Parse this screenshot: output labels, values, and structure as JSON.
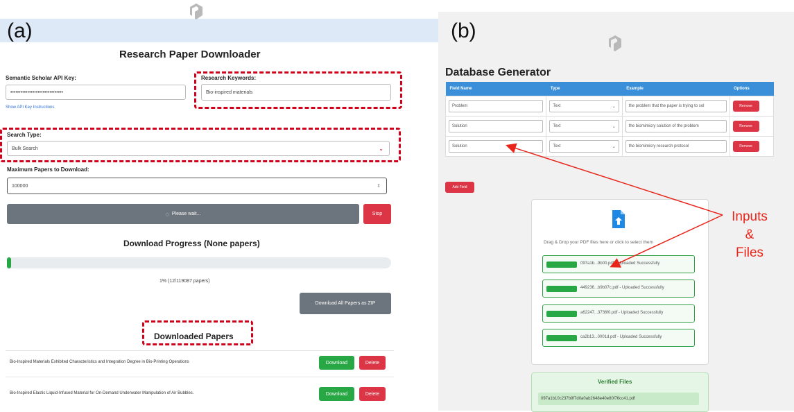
{
  "panels": {
    "a_label": "(a)",
    "b_label": "(b)"
  },
  "downloader": {
    "title": "Research Paper Downloader",
    "api_key_label": "Semantic Scholar API Key:",
    "api_key_value": "•••••••••••••••••••••••••••••••",
    "api_key_link": "Show API Key Instructions",
    "keywords_label": "Research Keywords:",
    "keywords_value": "Bio-inspired materials",
    "search_type_label": "Search Type:",
    "search_type_value": "Bulk Search",
    "max_papers_label": "Maximum Papers to Download:",
    "max_papers_value": "100000",
    "please_wait_label": "Please wait...",
    "stop_label": "Stop",
    "progress_title": "Download Progress (None papers)",
    "progress_fraction": 0.01,
    "progress_text": "1% (12/119087 papers)",
    "download_zip_label": "Download All Papers as ZIP",
    "downloaded_title": "Downloaded Papers",
    "papers": [
      {
        "title": "Bio-Inspired Materials Exhibited Characteristics and Integration Degree in Bio-Printing Operations",
        "download": "Download",
        "delete": "Delete"
      },
      {
        "title": "Bio-Inspired Elastic Liquid-Infused Material for On-Demand Underwater Manipulation of Air Bubbles.",
        "download": "Download",
        "delete": "Delete"
      }
    ]
  },
  "generator": {
    "title": "Database Generator",
    "columns": [
      "Field Name",
      "Type",
      "Example",
      "Options"
    ],
    "rows": [
      {
        "field": "Problem",
        "type": "Text",
        "example": "the problem that the paper is trying to sol",
        "option": "Remove"
      },
      {
        "field": "Solution",
        "type": "Text",
        "example": "the biomimicry solution of the problem",
        "option": "Remove"
      },
      {
        "field": "Solution",
        "type": "Text",
        "example": "the biomimicry research protocol",
        "option": "Remove"
      }
    ],
    "add_field_label": "Add Field",
    "upload_prompt": "Drag & Drop your PDF files here or click to select them",
    "files": [
      {
        "name": "097a1b...9b00.pdf - Uploaded Successfully"
      },
      {
        "name": "449236...b9b07c.pdf - Uploaded Successfully"
      },
      {
        "name": "a62247...3736f0.pdf - Uploaded Successfully"
      },
      {
        "name": "ca2b13...0001d.pdf - Uploaded Successfully"
      }
    ],
    "verified_title": "Verified Files",
    "verified_file": "097a1b10c237b9f7d0a0ab2648e40e80f76cc41.pdf"
  },
  "annotation": {
    "line1": "Inputs",
    "line2": "&",
    "line3": "Files"
  },
  "colors": {
    "dash": "#d0021b",
    "arrow": "#e8251a",
    "header": "#3a8fd8",
    "green": "#28a745",
    "red": "#dc3545"
  }
}
